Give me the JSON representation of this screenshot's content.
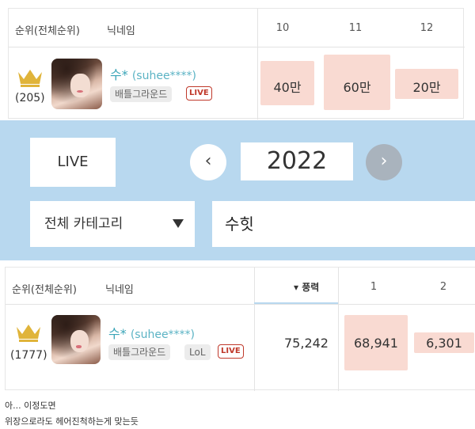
{
  "table1": {
    "headers": {
      "rank": "순위(전체순위)",
      "nickname": "닉네임",
      "cols": [
        "10",
        "11",
        "12"
      ]
    },
    "row": {
      "rank": "(205)",
      "nick_main": "수*",
      "nick_id": "(suhee****)",
      "tags": [
        "배틀그라운드"
      ],
      "live": "LIVE",
      "values": [
        "40만",
        "60만",
        "20만"
      ]
    }
  },
  "search_panel": {
    "live_button": "LIVE",
    "prev_icon": "‹",
    "year": "2022",
    "next_icon": "›",
    "category": "전체 카테고리",
    "search_value": "수힛"
  },
  "table2": {
    "headers": {
      "rank": "순위(전체순위)",
      "nickname": "닉네임",
      "sort_col": "▾ 풍력",
      "cols": [
        "1",
        "2"
      ]
    },
    "row": {
      "rank": "(1777)",
      "nick_main": "수*",
      "nick_id": "(suhee****)",
      "tags": [
        "배틀그라운드",
        "LoL"
      ],
      "live": "LIVE",
      "values": [
        "75,242",
        "68,941",
        "6,301"
      ]
    }
  },
  "caption": {
    "line1": "아... 이정도면",
    "line2": "위장으로라도 헤어진척하는게 맞는듯"
  },
  "colors": {
    "crown": "#e0b43a",
    "highlight": "#f9dad2",
    "panel": "#b8d8ef",
    "nick": "#3aa5b8",
    "live": "#c0392b"
  }
}
